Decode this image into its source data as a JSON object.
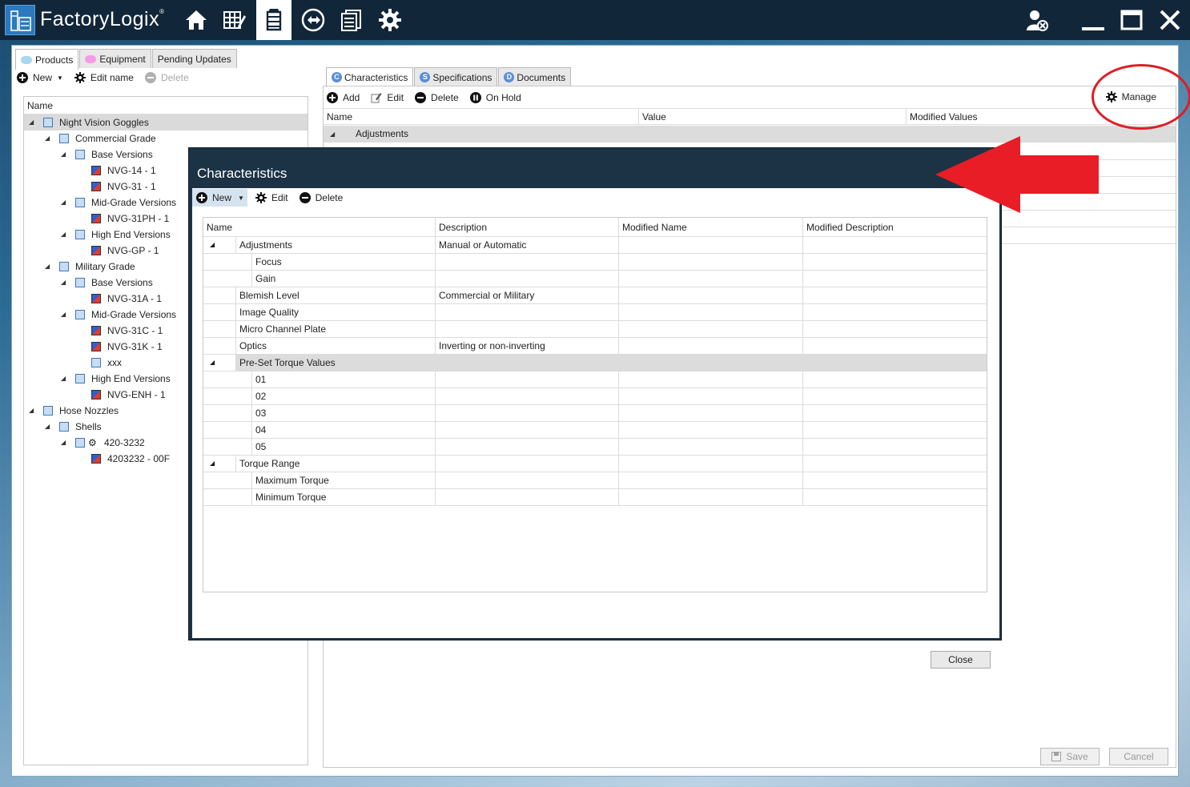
{
  "app": {
    "brand": "FactoryLogix",
    "nav_icons": [
      "home-icon",
      "grid-edit-icon",
      "product-tree-icon",
      "routing-icon",
      "documents-icon",
      "gear-icon"
    ],
    "active_nav": "product-tree-icon",
    "window_controls": [
      "user-logout-icon",
      "minimize-icon",
      "maximize-icon",
      "close-icon"
    ]
  },
  "left_tabs": [
    {
      "label": "Products",
      "color": "#a8d8ef",
      "active": true
    },
    {
      "label": "Equipment",
      "color": "#f59be6",
      "active": false
    },
    {
      "label": "Pending Updates",
      "active": false
    }
  ],
  "left_toolbar": {
    "new": "New",
    "edit_name": "Edit name",
    "delete": "Delete"
  },
  "tree": {
    "header": "Name",
    "nodes": [
      {
        "label": "Night Vision Goggles",
        "level": 0,
        "expanded": true,
        "selected": true,
        "icon": "folder"
      },
      {
        "label": "Commercial Grade",
        "level": 1,
        "expanded": true,
        "icon": "folder"
      },
      {
        "label": "Base Versions",
        "level": 2,
        "expanded": true,
        "icon": "folder"
      },
      {
        "label": "NVG-14 - 1",
        "level": 3,
        "icon": "part"
      },
      {
        "label": "NVG-31 - 1",
        "level": 3,
        "icon": "part"
      },
      {
        "label": "Mid-Grade Versions",
        "level": 2,
        "expanded": true,
        "icon": "folder"
      },
      {
        "label": "NVG-31PH - 1",
        "level": 3,
        "icon": "part"
      },
      {
        "label": "High End Versions",
        "level": 2,
        "expanded": true,
        "icon": "folder"
      },
      {
        "label": "NVG-GP - 1",
        "level": 3,
        "icon": "part"
      },
      {
        "label": "Military Grade",
        "level": 1,
        "expanded": true,
        "icon": "folder"
      },
      {
        "label": "Base Versions",
        "level": 2,
        "expanded": true,
        "icon": "folder"
      },
      {
        "label": "NVG-31A - 1",
        "level": 3,
        "icon": "part"
      },
      {
        "label": "Mid-Grade Versions",
        "level": 2,
        "expanded": true,
        "icon": "folder"
      },
      {
        "label": "NVG-31C - 1",
        "level": 3,
        "icon": "part"
      },
      {
        "label": "NVG-31K - 1",
        "level": 3,
        "icon": "part"
      },
      {
        "label": "xxx",
        "level": 3,
        "icon": "folder"
      },
      {
        "label": "High End Versions",
        "level": 2,
        "expanded": true,
        "icon": "folder"
      },
      {
        "label": "NVG-ENH - 1",
        "level": 3,
        "icon": "part"
      },
      {
        "label": "Hose Nozzles",
        "level": 0,
        "expanded": true,
        "icon": "folder"
      },
      {
        "label": "Shells",
        "level": 1,
        "expanded": true,
        "icon": "folder"
      },
      {
        "label": "420-3232",
        "level": 2,
        "expanded": true,
        "icon": "folder-gear"
      },
      {
        "label": "4203232 - 00F",
        "level": 3,
        "icon": "part"
      }
    ]
  },
  "right_tabs": [
    {
      "label": "Characteristics",
      "badge": "C",
      "active": true
    },
    {
      "label": "Specifications",
      "badge": "S",
      "active": false
    },
    {
      "label": "Documents",
      "badge": "D",
      "active": false
    }
  ],
  "right_toolbar": {
    "add": "Add",
    "edit": "Edit",
    "delete": "Delete",
    "on_hold": "On Hold",
    "manage": "Manage"
  },
  "right_grid": {
    "columns": [
      "Name",
      "Value",
      "Modified Values"
    ],
    "first_row": "Adjustments"
  },
  "bottom_buttons": {
    "save": "Save",
    "cancel": "Cancel"
  },
  "dialog": {
    "title": "Characteristics",
    "toolbar": {
      "new": "New",
      "edit": "Edit",
      "delete": "Delete"
    },
    "columns": [
      "Name",
      "Description",
      "Modified Name",
      "Modified Description"
    ],
    "rows": [
      {
        "name": "Adjustments",
        "description": "Manual or Automatic",
        "level": 0,
        "expander": true
      },
      {
        "name": "Focus",
        "description": "",
        "level": 1
      },
      {
        "name": "Gain",
        "description": "",
        "level": 1
      },
      {
        "name": "Blemish Level",
        "description": "Commercial or Military",
        "level": 0
      },
      {
        "name": "Image Quality",
        "description": "",
        "level": 0
      },
      {
        "name": "Micro Channel Plate",
        "description": "",
        "level": 0
      },
      {
        "name": "Optics",
        "description": "Inverting or non-inverting",
        "level": 0
      },
      {
        "name": "Pre-Set Torque Values",
        "description": "",
        "level": 0,
        "expander": true,
        "selected": true
      },
      {
        "name": "01",
        "description": "",
        "level": 1
      },
      {
        "name": "02",
        "description": "",
        "level": 1
      },
      {
        "name": "03",
        "description": "",
        "level": 1
      },
      {
        "name": "04",
        "description": "",
        "level": 1
      },
      {
        "name": "05",
        "description": "",
        "level": 1
      },
      {
        "name": "Torque Range",
        "description": "",
        "level": 0,
        "expander": true
      },
      {
        "name": "Maximum Torque",
        "description": "",
        "level": 1
      },
      {
        "name": "Minimum Torque",
        "description": "",
        "level": 1
      }
    ],
    "close": "Close"
  },
  "annotation": {
    "arrow_color": "#e81d25",
    "circle_color": "#e01c26"
  }
}
